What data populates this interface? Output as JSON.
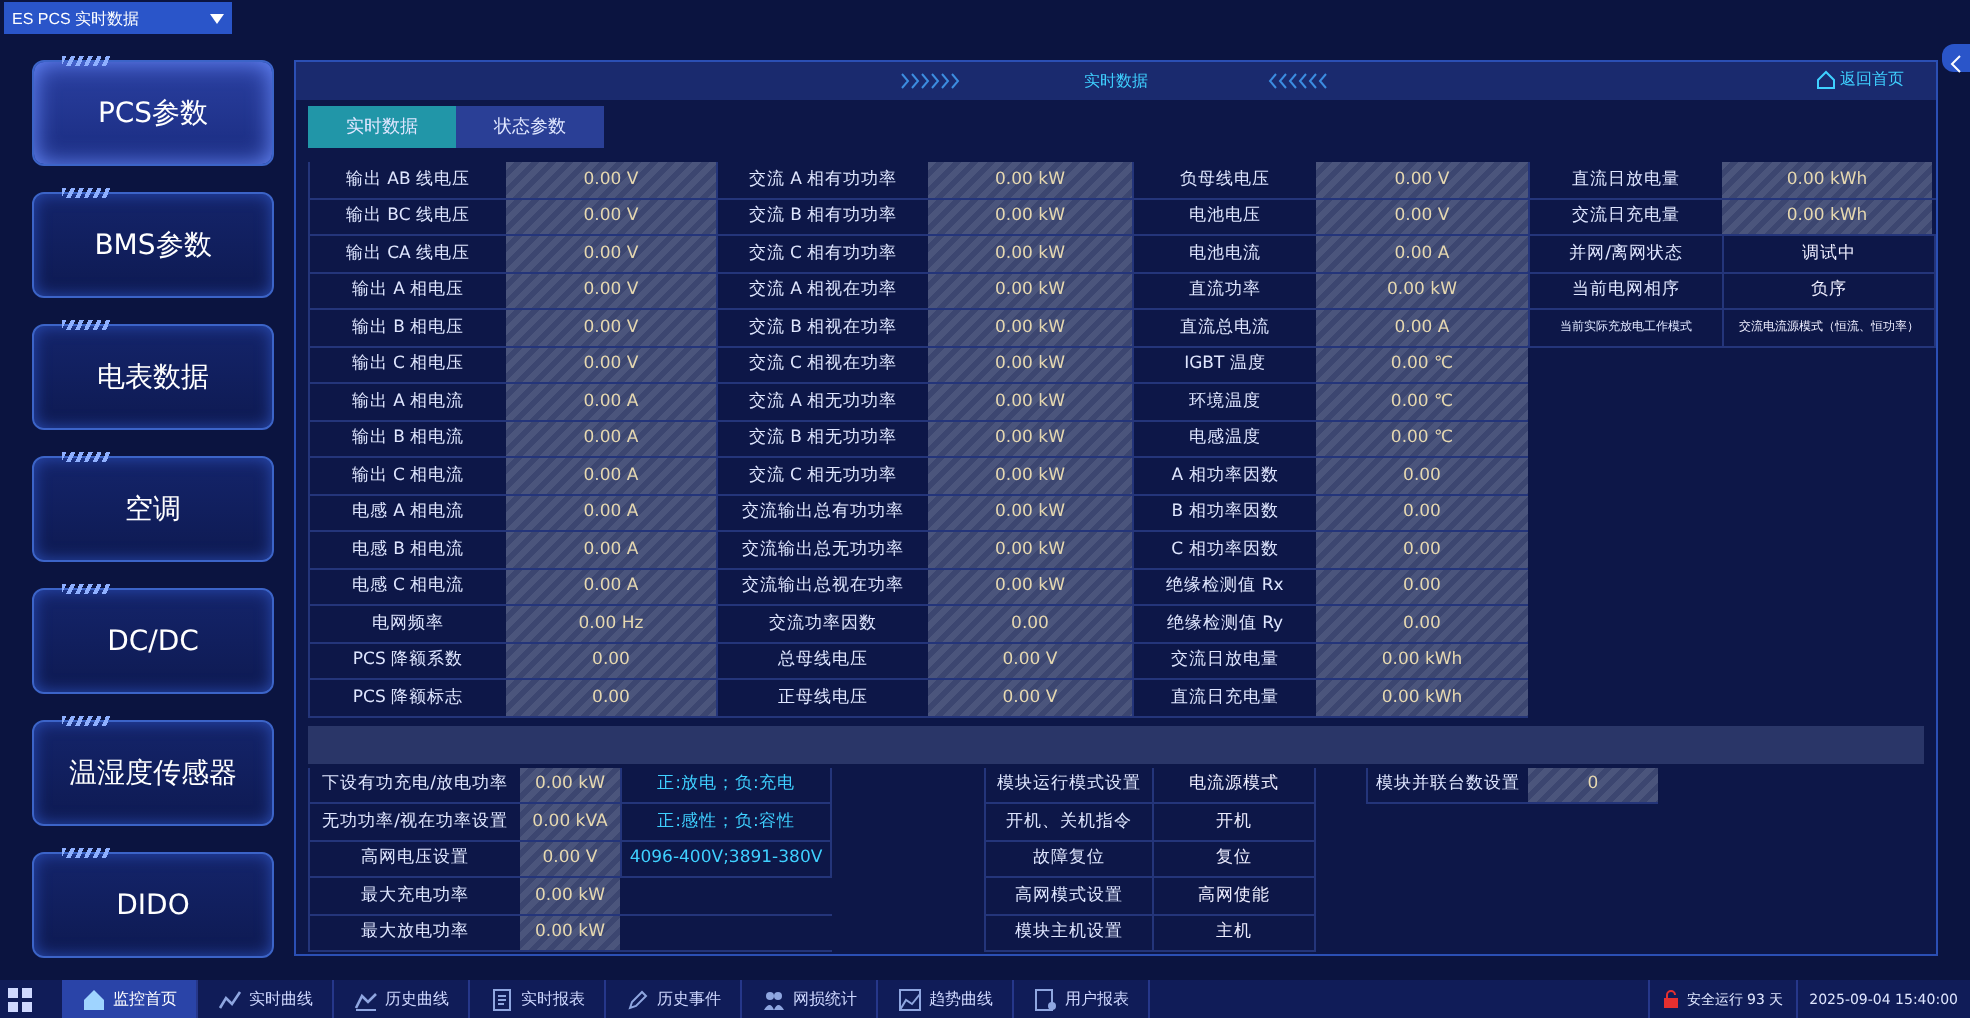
{
  "top_bar": {
    "dropdown": "ES PCS 实时数据"
  },
  "sidebar": {
    "items": [
      {
        "label": "PCS参数",
        "selected": true
      },
      {
        "label": "BMS参数",
        "selected": false
      },
      {
        "label": "电表数据",
        "selected": false
      },
      {
        "label": "空调",
        "selected": false
      },
      {
        "label": "DC/DC",
        "selected": false
      },
      {
        "label": "温湿度传感器",
        "selected": false
      },
      {
        "label": "DIDO",
        "selected": false
      }
    ]
  },
  "panel": {
    "title": "实时数据",
    "back_link": "返回首页",
    "tabs": [
      {
        "label": "实时数据",
        "selected": true
      },
      {
        "label": "状态参数",
        "selected": false
      }
    ],
    "columns": [
      [
        {
          "label": "输出 AB 线电压",
          "value": "0.00 V",
          "kind": "field"
        },
        {
          "label": "输出 BC 线电压",
          "value": "0.00 V",
          "kind": "field"
        },
        {
          "label": "输出 CA 线电压",
          "value": "0.00 V",
          "kind": "field"
        },
        {
          "label": "输出 A 相电压",
          "value": "0.00 V",
          "kind": "field"
        },
        {
          "label": "输出 B 相电压",
          "value": "0.00 V",
          "kind": "field"
        },
        {
          "label": "输出 C 相电压",
          "value": "0.00 V",
          "kind": "field"
        },
        {
          "label": "输出 A 相电流",
          "value": "0.00 A",
          "kind": "field"
        },
        {
          "label": "输出 B 相电流",
          "value": "0.00 A",
          "kind": "field"
        },
        {
          "label": "输出 C 相电流",
          "value": "0.00 A",
          "kind": "field"
        },
        {
          "label": "电感 A 相电流",
          "value": "0.00 A",
          "kind": "field"
        },
        {
          "label": "电感 B 相电流",
          "value": "0.00 A",
          "kind": "field"
        },
        {
          "label": "电感 C 相电流",
          "value": "0.00 A",
          "kind": "field"
        },
        {
          "label": "电网频率",
          "value": "0.00 Hz",
          "kind": "field"
        },
        {
          "label": "PCS 降额系数",
          "value": "0.00",
          "kind": "field"
        },
        {
          "label": "PCS 降额标志",
          "value": "0.00",
          "kind": "field"
        }
      ],
      [
        {
          "label": "交流 A 相有功功率",
          "value": "0.00 kW",
          "kind": "field"
        },
        {
          "label": "交流 B 相有功功率",
          "value": "0.00 kW",
          "kind": "field"
        },
        {
          "label": "交流 C 相有功功率",
          "value": "0.00 kW",
          "kind": "field"
        },
        {
          "label": "交流 A 相视在功率",
          "value": "0.00 kW",
          "kind": "field"
        },
        {
          "label": "交流 B 相视在功率",
          "value": "0.00 kW",
          "kind": "field"
        },
        {
          "label": "交流 C 相视在功率",
          "value": "0.00 kW",
          "kind": "field"
        },
        {
          "label": "交流 A 相无功功率",
          "value": "0.00 kW",
          "kind": "field"
        },
        {
          "label": "交流 B 相无功功率",
          "value": "0.00 kW",
          "kind": "field"
        },
        {
          "label": "交流 C 相无功功率",
          "value": "0.00 kW",
          "kind": "field"
        },
        {
          "label": "交流输出总有功功率",
          "value": "0.00 kW",
          "kind": "field"
        },
        {
          "label": "交流输出总无功功率",
          "value": "0.00 kW",
          "kind": "field"
        },
        {
          "label": "交流输出总视在功率",
          "value": "0.00 kW",
          "kind": "field"
        },
        {
          "label": "交流功率因数",
          "value": "0.00",
          "kind": "field"
        },
        {
          "label": "总母线电压",
          "value": "0.00 V",
          "kind": "field"
        },
        {
          "label": "正母线电压",
          "value": "0.00 V",
          "kind": "field"
        }
      ],
      [
        {
          "label": "负母线电压",
          "value": "0.00 V",
          "kind": "field"
        },
        {
          "label": "电池电压",
          "value": "0.00 V",
          "kind": "field"
        },
        {
          "label": "电池电流",
          "value": "0.00 A",
          "kind": "field"
        },
        {
          "label": "直流功率",
          "value": "0.00 kW",
          "kind": "field"
        },
        {
          "label": "直流总电流",
          "value": "0.00 A",
          "kind": "field"
        },
        {
          "label": "IGBT 温度",
          "value": "0.00 ℃",
          "kind": "field"
        },
        {
          "label": "环境温度",
          "value": "0.00 ℃",
          "kind": "field"
        },
        {
          "label": "电感温度",
          "value": "0.00 ℃",
          "kind": "field"
        },
        {
          "label": "A 相功率因数",
          "value": "0.00",
          "kind": "field"
        },
        {
          "label": "B 相功率因数",
          "value": "0.00",
          "kind": "field"
        },
        {
          "label": "C 相功率因数",
          "value": "0.00",
          "kind": "field"
        },
        {
          "label": "绝缘检测值 Rx",
          "value": "0.00",
          "kind": "field"
        },
        {
          "label": "绝缘检测值 Ry",
          "value": "0.00",
          "kind": "field"
        },
        {
          "label": "交流日放电量",
          "value": "0.00 kWh",
          "kind": "field"
        },
        {
          "label": "直流日充电量",
          "value": "0.00 kWh",
          "kind": "field"
        }
      ],
      [
        {
          "label": "直流日放电量",
          "value": "0.00 kWh",
          "kind": "field"
        },
        {
          "label": "交流日充电量",
          "value": "0.00 kWh",
          "kind": "field"
        },
        {
          "label": "并网/离网状态",
          "value": "调试中",
          "kind": "text"
        },
        {
          "label": "当前电网相序",
          "value": "负序",
          "kind": "text"
        },
        {
          "label": "当前实际充放电工作模式",
          "value": "交流电流源模式（恒流、恒功率）",
          "kind": "small"
        }
      ]
    ],
    "settings": [
      [
        {
          "label": "下设有功充电/放电功率",
          "value": "0.00 kW",
          "kind": "field",
          "note": "正:放电；负:充电"
        },
        {
          "label": "无功功率/视在功率设置",
          "value": "0.00 kVA",
          "kind": "field",
          "note": "正:感性；负:容性"
        },
        {
          "label": "高网电压设置",
          "value": "0.00 V",
          "kind": "field",
          "note": "4096-400V;3891-380V"
        },
        {
          "label": "最大充电功率",
          "value": "0.00 kW",
          "kind": "field"
        },
        {
          "label": "最大放电功率",
          "value": "0.00 kW",
          "kind": "field"
        }
      ],
      [
        {
          "label": "模块运行模式设置",
          "value": "电流源模式",
          "kind": "text"
        },
        {
          "label": "开机、关机指令",
          "value": "开机",
          "kind": "text"
        },
        {
          "label": "故障复位",
          "value": "复位",
          "kind": "text"
        },
        {
          "label": "高网模式设置",
          "value": "高网使能",
          "kind": "text"
        },
        {
          "label": "模块主机设置",
          "value": "主机",
          "kind": "text"
        }
      ],
      [
        {
          "label": "模块并联台数设置",
          "value": "0",
          "kind": "field"
        }
      ]
    ]
  },
  "taskbar": {
    "items": [
      {
        "label": "监控首页",
        "selected": true
      },
      {
        "label": "实时曲线",
        "selected": false
      },
      {
        "label": "历史曲线",
        "selected": false
      },
      {
        "label": "实时报表",
        "selected": false
      },
      {
        "label": "历史事件",
        "selected": false
      },
      {
        "label": "网损统计",
        "selected": false
      },
      {
        "label": "趋势曲线",
        "selected": false
      },
      {
        "label": "用户报表",
        "selected": false
      }
    ],
    "safe_days": "安全运行 93 天",
    "datetime": "2025-09-04 15:40:00"
  }
}
